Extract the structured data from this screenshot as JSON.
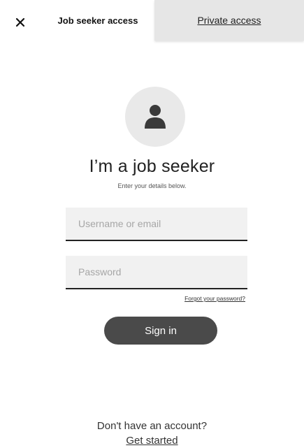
{
  "header": {
    "close_icon": "close-icon",
    "tabs": [
      {
        "label": "Job seeker access",
        "active": true
      },
      {
        "label": "Private access",
        "active": false
      }
    ]
  },
  "profile": {
    "avatar_icon": "person-icon",
    "title": "I’m a job seeker",
    "subtitle": "Enter your details below."
  },
  "form": {
    "username": {
      "placeholder": "Username or email",
      "value": ""
    },
    "password": {
      "placeholder": "Password",
      "value": ""
    },
    "forgot_label": "Forgot your password?",
    "signin_label": "Sign in"
  },
  "footer": {
    "prompt": "Don't have an account?",
    "link_label": "Get started"
  },
  "colors": {
    "inactive_tab_bg": "#e6e6e6",
    "button_bg": "#4a4a4a",
    "field_bg": "#f1f1f1",
    "avatar_bg": "#e9e9e9"
  }
}
